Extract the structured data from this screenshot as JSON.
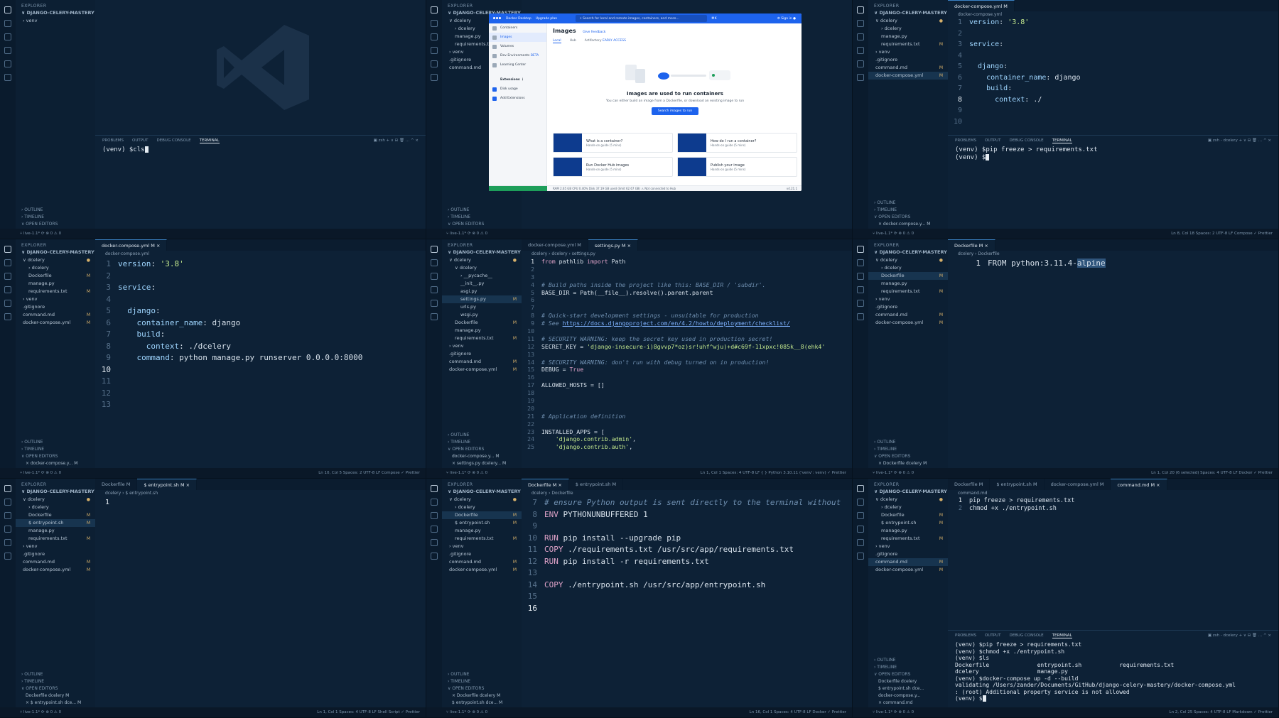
{
  "explorer_title": "EXPLORER",
  "project_root": "DJANGO-CELERY-MASTERY",
  "outline": "OUTLINE",
  "timeline": "TIMELINE",
  "open_editors": "OPEN EDITORS",
  "branch": "live-1.1*",
  "panels": [
    {
      "id": "p1",
      "tree": [
        {
          "t": "› venv",
          "d": 0
        }
      ],
      "tabs": [],
      "breadcrumb": "",
      "lines": [],
      "terminal_tabs": [
        "PROBLEMS",
        "OUTPUT",
        "DEBUG CONSOLE",
        "TERMINAL"
      ],
      "terminal_shell": "zsh",
      "terminal": [
        "(venv) $cls"
      ],
      "open_editors": [],
      "status_right": ""
    },
    {
      "id": "p2",
      "tree": [
        {
          "t": "∨ dcelery",
          "d": 0,
          "m": "●"
        },
        {
          "t": "› dcelery",
          "d": 1
        },
        {
          "t": "manage.py",
          "d": 1
        },
        {
          "t": "requirements.txt",
          "d": 1,
          "m": "M"
        },
        {
          "t": "› venv",
          "d": 0
        },
        {
          "t": ".gitignore",
          "d": 0
        },
        {
          "t": "command.md",
          "d": 0,
          "m": "M"
        }
      ],
      "tabs": [],
      "breadcrumb": "",
      "lines": [],
      "terminal": [],
      "open_editors": [],
      "status_right": ""
    },
    {
      "id": "p3",
      "tree": [
        {
          "t": "∨ dcelery",
          "d": 0,
          "m": "●"
        },
        {
          "t": "› dcelery",
          "d": 1
        },
        {
          "t": "manage.py",
          "d": 1
        },
        {
          "t": "requirements.txt",
          "d": 1,
          "m": "M"
        },
        {
          "t": "› venv",
          "d": 0
        },
        {
          "t": ".gitignore",
          "d": 0
        },
        {
          "t": "command.md",
          "d": 0,
          "m": "M"
        },
        {
          "t": "docker-compose.yml",
          "d": 0,
          "m": "M",
          "sel": true
        }
      ],
      "tabs": [
        {
          "t": "docker-compose.yml M",
          "on": true
        }
      ],
      "breadcrumb": "docker-compose.yml",
      "lines": [
        "version: '3.8'",
        "",
        "service:",
        "",
        "  django:",
        "    container_name: django",
        "    build:",
        "      context: ./",
        "",
        ""
      ],
      "cur": 8,
      "terminal_tabs": [
        "PROBLEMS",
        "OUTPUT",
        "DEBUG CONSOLE",
        "TERMINAL"
      ],
      "terminal_shell": "zsh - dcelery",
      "terminal": [
        "(venv) $pip freeze > requirements.txt",
        "(venv) $"
      ],
      "open_editors": [
        "× docker-compose.y... M"
      ],
      "status_right": "Ln 8, Col 18   Spaces: 2   UTF-8   LF   Compose   ✓ Prettier"
    },
    {
      "id": "p4",
      "tree": [
        {
          "t": "∨ dcelery",
          "d": 0,
          "m": "●"
        },
        {
          "t": "› dcelery",
          "d": 1
        },
        {
          "t": "Dockerfile",
          "d": 1,
          "m": "M"
        },
        {
          "t": "manage.py",
          "d": 1
        },
        {
          "t": "requirements.txt",
          "d": 1,
          "m": "M"
        },
        {
          "t": "› venv",
          "d": 0
        },
        {
          "t": ".gitignore",
          "d": 0
        },
        {
          "t": "command.md",
          "d": 0,
          "m": "M"
        },
        {
          "t": "docker-compose.yml",
          "d": 0,
          "m": "M"
        }
      ],
      "tabs": [
        {
          "t": "docker-compose.yml M ×",
          "on": true
        }
      ],
      "breadcrumb": "docker-compose.yml",
      "lines": [
        "version: '3.8'",
        "",
        "service:",
        "",
        "  django:",
        "    container_name: django",
        "    build:",
        "      context: ./dcelery",
        "    command: python manage.py runserver 0.0.0.0:8000",
        "",
        "",
        "",
        ""
      ],
      "cur": 10,
      "terminal": [],
      "open_editors": [
        "× docker-compose.y... M"
      ],
      "status_right": "Ln 10, Col 5   Spaces: 2   UTF-8   LF   Compose   ✓ Prettier"
    },
    {
      "id": "p5",
      "tree": [
        {
          "t": "∨ dcelery",
          "d": 0,
          "m": "●"
        },
        {
          "t": "∨ dcelery",
          "d": 1
        },
        {
          "t": "› __pycache__",
          "d": 2
        },
        {
          "t": "__init__.py",
          "d": 2
        },
        {
          "t": "asgi.py",
          "d": 2
        },
        {
          "t": "settings.py",
          "d": 2,
          "m": "M",
          "sel": true
        },
        {
          "t": "urls.py",
          "d": 2
        },
        {
          "t": "wsgi.py",
          "d": 2
        },
        {
          "t": "Dockerfile",
          "d": 1,
          "m": "M"
        },
        {
          "t": "manage.py",
          "d": 1
        },
        {
          "t": "requirements.txt",
          "d": 1,
          "m": "M"
        },
        {
          "t": "› venv",
          "d": 0
        },
        {
          "t": ".gitignore",
          "d": 0
        },
        {
          "t": "command.md",
          "d": 0,
          "m": "M"
        },
        {
          "t": "docker-compose.yml",
          "d": 0,
          "m": "M"
        }
      ],
      "tabs": [
        {
          "t": "docker-compose.yml M",
          "on": false
        },
        {
          "t": "settings.py M ×",
          "on": true
        }
      ],
      "breadcrumb": "dcelery › dcelery › settings.py",
      "lines_html": true,
      "lines": [
        "<span class=\"kw\">from</span> pathlib <span class=\"kw\">import</span> Path",
        "",
        "",
        "<span class=\"cm\"># Build paths inside the project like this: BASE_DIR / 'subdir'.</span>",
        "BASE_DIR = Path(__file__).resolve().parent.parent",
        "",
        "",
        "<span class=\"cm\"># Quick-start development settings - unsuitable for production</span>",
        "<span class=\"cm\"># See </span><span class=\"lnk\">https://docs.djangoproject.com/en/4.2/howto/deployment/checklist/</span>",
        "",
        "<span class=\"cm\"># SECURITY WARNING: keep the secret key used in production secret!</span>",
        "SECRET_KEY = <span class=\"str\">'django-insecure-i)8gvvp7*oz)sr!uhf^wju)+d#c69f-11xpxc!085k__8(ehk4'</span>",
        "",
        "<span class=\"cm\"># SECURITY WARNING: don't run with debug turned on in production!</span>",
        "DEBUG = <span class=\"kw\">True</span>",
        "",
        "ALLOWED_HOSTS = []",
        "",
        "",
        "",
        "<span class=\"cm\"># Application definition</span>",
        "",
        "INSTALLED_APPS = [",
        "    <span class=\"str\">'django.contrib.admin'</span>,",
        "    <span class=\"str\">'django.contrib.auth'</span>,"
      ],
      "cur": 1,
      "terminal": [],
      "open_editors": [
        "docker-compose.y... M",
        "× settings.py dcelery... M"
      ],
      "status_right": "Ln 1, Col 1   Spaces: 4   UTF-8   LF   { } Python   3.10.11 ('venv': venv)   ✓ Prettier"
    },
    {
      "id": "p6",
      "tree": [
        {
          "t": "∨ dcelery",
          "d": 0,
          "m": "●"
        },
        {
          "t": "› dcelery",
          "d": 1
        },
        {
          "t": "Dockerfile",
          "d": 1,
          "m": "M",
          "sel": true
        },
        {
          "t": "manage.py",
          "d": 1
        },
        {
          "t": "requirements.txt",
          "d": 1,
          "m": "M"
        },
        {
          "t": "› venv",
          "d": 0
        },
        {
          "t": ".gitignore",
          "d": 0
        },
        {
          "t": "command.md",
          "d": 0,
          "m": "M"
        },
        {
          "t": "docker-compose.yml",
          "d": 0,
          "m": "M"
        }
      ],
      "tabs": [
        {
          "t": "Dockerfile M ×",
          "on": true
        }
      ],
      "breadcrumb": "dcelery › Dockerfile",
      "lines_html": true,
      "lines": [
        "FROM python:3.11.4-<span class=\"sel2\">alpine</span>"
      ],
      "cur": 1,
      "terminal": [],
      "open_editors": [
        "× Dockerfile dcelery M"
      ],
      "status_right": "Ln 1, Col 20 (6 selected)   Spaces: 4   UTF-8   LF   Docker   ✓ Prettier"
    },
    {
      "id": "p7",
      "tree": [
        {
          "t": "∨ dcelery",
          "d": 0,
          "m": "●"
        },
        {
          "t": "› dcelery",
          "d": 1
        },
        {
          "t": "Dockerfile",
          "d": 1,
          "m": "M"
        },
        {
          "t": "$ entrypoint.sh",
          "d": 1,
          "m": "M",
          "sel": true
        },
        {
          "t": "manage.py",
          "d": 1
        },
        {
          "t": "requirements.txt",
          "d": 1,
          "m": "M"
        },
        {
          "t": "› venv",
          "d": 0
        },
        {
          "t": ".gitignore",
          "d": 0
        },
        {
          "t": "command.md",
          "d": 0,
          "m": "M"
        },
        {
          "t": "docker-compose.yml",
          "d": 0,
          "m": "M"
        }
      ],
      "tabs": [
        {
          "t": "Dockerfile M",
          "on": false
        },
        {
          "t": "$ entrypoint.sh M ×",
          "on": true
        }
      ],
      "breadcrumb": "dcelery › $ entrypoint.sh",
      "lines": [
        ""
      ],
      "cur": 1,
      "terminal": [],
      "open_editors": [
        "Dockerfile dcelery M",
        "× $ entrypoint.sh dce... M"
      ],
      "status_right": "Ln 1, Col 1   Spaces: 4   UTF-8   LF   Shell Script   ✓ Prettier"
    },
    {
      "id": "p8",
      "tree": [
        {
          "t": "∨ dcelery",
          "d": 0,
          "m": "●"
        },
        {
          "t": "› dcelery",
          "d": 1
        },
        {
          "t": "Dockerfile",
          "d": 1,
          "m": "M",
          "sel": true
        },
        {
          "t": "$ entrypoint.sh",
          "d": 1,
          "m": "M"
        },
        {
          "t": "manage.py",
          "d": 1
        },
        {
          "t": "requirements.txt",
          "d": 1,
          "m": "M"
        },
        {
          "t": "› venv",
          "d": 0
        },
        {
          "t": ".gitignore",
          "d": 0
        },
        {
          "t": "command.md",
          "d": 0,
          "m": "M"
        },
        {
          "t": "docker-compose.yml",
          "d": 0,
          "m": "M"
        }
      ],
      "tabs": [
        {
          "t": "Dockerfile M ×",
          "on": true
        },
        {
          "t": "$ entrypoint.sh M",
          "on": false
        }
      ],
      "breadcrumb": "dcelery › Dockerfile",
      "lines": [
        "# ensure Python output is sent directly to the terminal without",
        "ENV PYTHONUNBUFFERED 1",
        "",
        "RUN pip install --upgrade pip",
        "COPY ./requirements.txt /usr/src/app/requirements.txt",
        "RUN pip install -r requirements.txt",
        "",
        "COPY ./entrypoint.sh /usr/src/app/entrypoint.sh",
        "",
        ""
      ],
      "start": 7,
      "cur": 16,
      "terminal": [],
      "open_editors": [
        "× Dockerfile dcelery M",
        "$ entrypoint.sh dce... M"
      ],
      "status_right": "Ln 16, Col 1   Spaces: 4   UTF-8   LF   Docker   ✓ Prettier"
    },
    {
      "id": "p9",
      "tree": [
        {
          "t": "∨ dcelery",
          "d": 0,
          "m": "●"
        },
        {
          "t": "› dcelery",
          "d": 1
        },
        {
          "t": "Dockerfile",
          "d": 1,
          "m": "M"
        },
        {
          "t": "$ entrypoint.sh",
          "d": 1,
          "m": "M"
        },
        {
          "t": "manage.py",
          "d": 1
        },
        {
          "t": "requirements.txt",
          "d": 1,
          "m": "M"
        },
        {
          "t": "› venv",
          "d": 0
        },
        {
          "t": ".gitignore",
          "d": 0
        },
        {
          "t": "command.md",
          "d": 0,
          "m": "M",
          "sel": true
        },
        {
          "t": "docker-compose.yml",
          "d": 0,
          "m": "M"
        }
      ],
      "tabs": [
        {
          "t": "Dockerfile M",
          "on": false
        },
        {
          "t": "$ entrypoint.sh M",
          "on": false
        },
        {
          "t": "docker-compose.yml M",
          "on": false
        },
        {
          "t": "command.md M ×",
          "on": true
        }
      ],
      "breadcrumb": "command.md",
      "lines": [
        "pip freeze > requirements.txt",
        "chmod +x ./entrypoint.sh"
      ],
      "cur": 1,
      "terminal_tabs": [
        "PROBLEMS",
        "OUTPUT",
        "DEBUG CONSOLE",
        "TERMINAL"
      ],
      "terminal_shell": "zsh - dcelery",
      "terminal": [
        "(venv) $pip freeze > requirements.txt",
        "(venv) $chmod +x ./entrypoint.sh",
        "(venv) $ls",
        "Dockerfile              entrypoint.sh           requirements.txt",
        "dcelery                 manage.py",
        "(venv) $docker-compose up -d --build",
        "validating /Users/zander/Documents/GitHub/django-celery-mastery/docker-compose.yml",
        ": (root) Additional property service is not allowed",
        "(venv) $"
      ],
      "open_editors": [
        "Dockerfile dcelery",
        "$ entrypoint.sh dce...",
        "docker-compose.y...",
        "× command.md"
      ],
      "status_right": "Ln 2, Col 25   Spaces: 4   UTF-8   LF   Markdown   ✓ Prettier"
    }
  ],
  "docker": {
    "app_title": "Docker Desktop",
    "upgrade": "Upgrade plan",
    "search_placeholder": "Search for local and remote images, containers, and more...",
    "shortcut": "⌘K",
    "sign_in": "Sign in",
    "nav": [
      "Containers",
      "Images",
      "Volumes",
      "Dev Environments",
      "Learning Center"
    ],
    "nav_beta": "BETA",
    "extensions": "Extensions",
    "ext_items": [
      "Disk usage",
      "Add Extensions"
    ],
    "heading": "Images",
    "feedback": "Give feedback",
    "tabs": [
      "Local",
      "Hub",
      "Artifactory"
    ],
    "early_access": "EARLY ACCESS",
    "empty_title": "Images are used to run containers",
    "empty_sub": "You can either build an image from a Dockerfile, or download an existing image to run",
    "search_btn": "Search images to run",
    "cards": [
      {
        "t": "What is a container?",
        "s": "Hands-on guide (5 mins)"
      },
      {
        "t": "How do I run a container?",
        "s": "Hands-on guide (5 mins)"
      },
      {
        "t": "Run Docker Hub images",
        "s": "Hands-on guide (5 mins)"
      },
      {
        "t": "Publish your image",
        "s": "Hands-on guide (5 mins)"
      }
    ],
    "status": "RAM 2.65 GB   CPU 0.40%   Disk 37.19 GB used (limit 62.67 GB)   ⚠ Not connected to Hub",
    "version": "v4.21.1"
  },
  "colors": {
    "accent": "#3b82c4",
    "modified": "#d6b06a",
    "docker_blue": "#1d63ed"
  }
}
